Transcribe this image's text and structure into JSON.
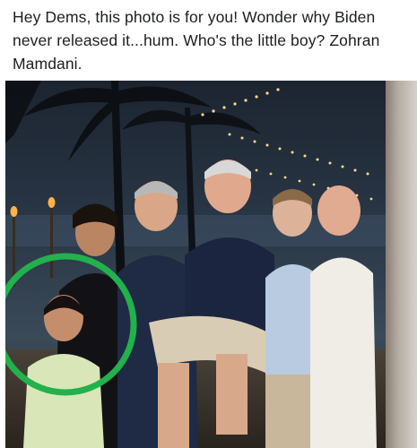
{
  "post": {
    "text": "Hey Dems, this photo is for you!  Wonder why Biden never released it...hum.  Who's the little boy? Zohran Mamdani."
  },
  "photo": {
    "description_icon": "group-photo-icon",
    "highlight_color": "#22b14c"
  }
}
